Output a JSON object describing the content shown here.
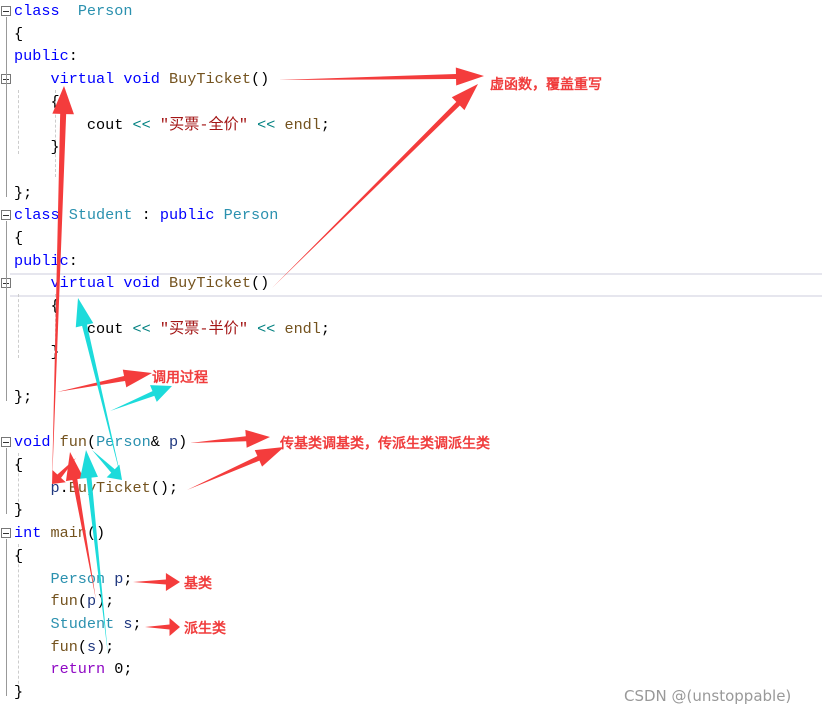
{
  "code_lines": [
    [
      [
        "kw",
        "class"
      ],
      [
        "",
        "  "
      ],
      [
        "ty",
        "Person"
      ]
    ],
    [
      [
        "",
        "{"
      ]
    ],
    [
      [
        "kw",
        "public"
      ],
      [
        "",
        ":"
      ]
    ],
    [
      [
        "",
        "    "
      ],
      [
        "kw",
        "virtual"
      ],
      [
        "",
        " "
      ],
      [
        "kw",
        "void"
      ],
      [
        "",
        " "
      ],
      [
        "fn",
        "BuyTicket"
      ],
      [
        "",
        "()"
      ]
    ],
    [
      [
        "",
        "    {"
      ]
    ],
    [
      [
        "",
        "        "
      ],
      [
        "",
        "cout"
      ],
      [
        "",
        " "
      ],
      [
        "op",
        "<<"
      ],
      [
        "",
        " "
      ],
      [
        "st",
        "\"买票-全价\""
      ],
      [
        "",
        " "
      ],
      [
        "op",
        "<<"
      ],
      [
        "",
        " "
      ],
      [
        "fn",
        "endl"
      ],
      [
        "",
        ";"
      ]
    ],
    [
      [
        "",
        "    }"
      ]
    ],
    [
      [
        "",
        ""
      ]
    ],
    [
      [
        "",
        "};"
      ]
    ],
    [
      [
        "kw",
        "class"
      ],
      [
        "",
        " "
      ],
      [
        "ty",
        "Student"
      ],
      [
        "",
        " : "
      ],
      [
        "kw",
        "public"
      ],
      [
        "",
        " "
      ],
      [
        "ty",
        "Person"
      ]
    ],
    [
      [
        "",
        "{"
      ]
    ],
    [
      [
        "kw",
        "public"
      ],
      [
        "",
        ":"
      ]
    ],
    [
      [
        "",
        "    "
      ],
      [
        "kw",
        "virtual"
      ],
      [
        "",
        " "
      ],
      [
        "kw",
        "void"
      ],
      [
        "",
        " "
      ],
      [
        "fn",
        "BuyTicket"
      ],
      [
        "",
        "()"
      ]
    ],
    [
      [
        "",
        "    {"
      ]
    ],
    [
      [
        "",
        "        "
      ],
      [
        "",
        "cout"
      ],
      [
        "",
        " "
      ],
      [
        "op",
        "<<"
      ],
      [
        "",
        " "
      ],
      [
        "st",
        "\"买票-半价\""
      ],
      [
        "",
        " "
      ],
      [
        "op",
        "<<"
      ],
      [
        "",
        " "
      ],
      [
        "fn",
        "endl"
      ],
      [
        "",
        ";"
      ]
    ],
    [
      [
        "",
        "    }"
      ]
    ],
    [
      [
        "",
        ""
      ]
    ],
    [
      [
        "",
        "};"
      ]
    ],
    [
      [
        "",
        ""
      ]
    ],
    [
      [
        "kw",
        "void"
      ],
      [
        "",
        " "
      ],
      [
        "fn",
        "fun"
      ],
      [
        "",
        "("
      ],
      [
        "ty",
        "Person"
      ],
      [
        "",
        "& "
      ],
      [
        "va",
        "p"
      ],
      [
        "",
        ")"
      ]
    ],
    [
      [
        "",
        "{"
      ]
    ],
    [
      [
        "",
        "    "
      ],
      [
        "va",
        "p"
      ],
      [
        "",
        "."
      ],
      [
        "fn",
        "BuyTicket"
      ],
      [
        "",
        "();"
      ]
    ],
    [
      [
        "",
        "}"
      ]
    ],
    [
      [
        "kw",
        "int"
      ],
      [
        "",
        " "
      ],
      [
        "fn",
        "main"
      ],
      [
        "",
        "()"
      ]
    ],
    [
      [
        "",
        "{"
      ]
    ],
    [
      [
        "",
        "    "
      ],
      [
        "ty",
        "Person"
      ],
      [
        "",
        " "
      ],
      [
        "va",
        "p"
      ],
      [
        "",
        ";"
      ]
    ],
    [
      [
        "",
        "    "
      ],
      [
        "fn",
        "fun"
      ],
      [
        "",
        "("
      ],
      [
        "va",
        "p"
      ],
      [
        "",
        ");"
      ]
    ],
    [
      [
        "",
        "    "
      ],
      [
        "ty",
        "Student"
      ],
      [
        "",
        " "
      ],
      [
        "va",
        "s"
      ],
      [
        "",
        ";"
      ]
    ],
    [
      [
        "",
        "    "
      ],
      [
        "fn",
        "fun"
      ],
      [
        "",
        "("
      ],
      [
        "va",
        "s"
      ],
      [
        "",
        ");"
      ]
    ],
    [
      [
        "",
        "    "
      ],
      [
        "ret",
        "return"
      ],
      [
        "",
        " 0;"
      ]
    ],
    [
      [
        "",
        "}"
      ]
    ]
  ],
  "annotations": {
    "virtual_override": "虚函数，覆盖重写",
    "call_process": "调用过程",
    "dispatch_rule": "传基类调基类，传派生类调派生类",
    "base_class": "基类",
    "derived_class": "派生类"
  },
  "watermark": "CSDN @(unstoppable)",
  "colors": {
    "arrow_red": "#f43c3c",
    "arrow_cyan": "#1ddbdb",
    "keyword": "#0000ff",
    "type": "#2b91af",
    "function": "#74531f",
    "string": "#a31515"
  }
}
